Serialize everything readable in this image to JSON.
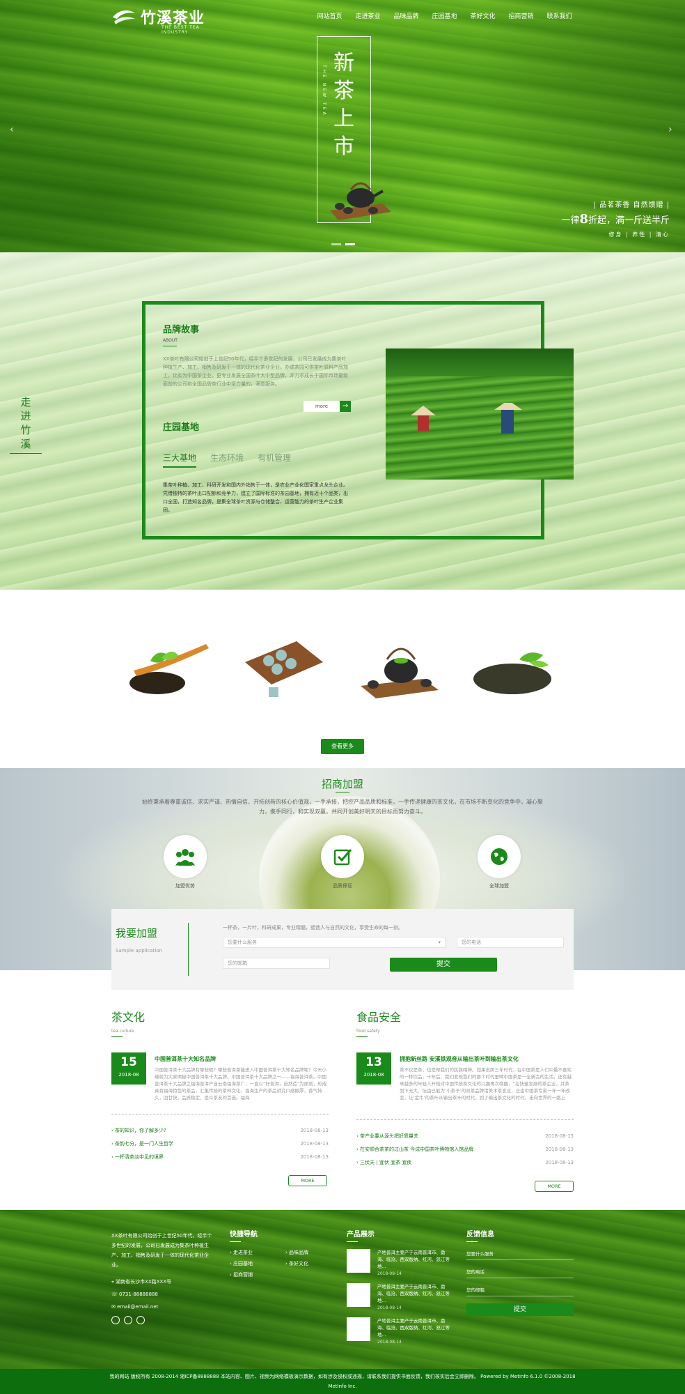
{
  "header": {
    "logo_text": "竹溪茶业",
    "logo_sub": "THE BEST TEA INDUSTRY",
    "nav": [
      "网站首页",
      "走进茶业",
      "品味品牌",
      "庄园基地",
      "茶好文化",
      "招商营销",
      "联系我们"
    ]
  },
  "hero": {
    "card_title": "新茶上市",
    "card_en": "THE NEW TEA",
    "slogan_line1": "| 品茗茶香 自然馈赠 |",
    "slogan_line2_a": "一律",
    "slogan_line2_b": "8",
    "slogan_line2_c": "折起，满一斤送半斤",
    "slogan_line3": "修身 | 养性 | 清心"
  },
  "about": {
    "side_title": "走进竹溪",
    "brand_title": "品牌故事",
    "brand_en": "ABOUT",
    "brand_text": "XX茶叶有限公司始创于上世纪50年代，经半个多世纪的发展，公司已发展成为集茶叶种植生产、加工、销售及研发于一体的现代化茶业企业。办成茶园可供茶叶原料产品加工，比实为中国茶企业。更专业发展全国茶叶大中型品牌，并力求成长于国际市场量级面前的公司和全国品牌茶行业中坚力量的，满意服务。",
    "more": "more",
    "base_title": "庄园基地",
    "tabs": [
      "三大基地",
      "生态环境",
      "有机管理"
    ],
    "base_text": "集茶叶种植、加工、科研开发和国内外销售于一体，是农业产业化国家重点龙头企业。凭借独特的茶叶出口配额和竞争力，建立了国际标准的茶园基地，拥有近十个品类，出口全国，打造知名品牌，是集全球茶叶资源与仓储整合、运营能力的茶叶生产企业集团。"
  },
  "products": {
    "items": [
      "茶叶与木勺",
      "功夫茶具套装",
      "茶壶与茶杯",
      "散装绿茶"
    ],
    "view_more": "查看更多"
  },
  "franchise": {
    "title": "招商加盟",
    "desc": "始终秉承着尊重诚信、求实严谨、热情自信、开拓创新的核心价值观，一手承接，把控产品品质和标准，一手传递健康的茶文化，在市场不断变化的竞争中，凝心聚力，携手同行，和实现双赢，共同开创美好明天的目标而努力奋斗。",
    "features": [
      "加盟优势",
      "品质保证",
      "全球加盟"
    ]
  },
  "join": {
    "title": "我要加盟",
    "en": "Sample application",
    "tip": "一杯茶，一片叶，科研成果，专业精髓，塑造人与自然的文化，享受生命的每一刻。",
    "select": "您要什么服务",
    "phone": "您的电话",
    "email": "您的邮箱",
    "submit": "提交"
  },
  "news": {
    "culture": {
      "title": "茶文化",
      "en": "tea culture",
      "day": "15",
      "ym": "2018-08",
      "feat_title": "中国普洱茶十大知名品牌",
      "feat_text": "中国普洱茶十大品牌有哪些呢？哪些普洱茶能进入中国普洱茶十大知名品牌呢？今天小编就为大家揭秘中国普洱茶十大品牌。中国普洱茶十大品牌之一——福海普洱茶。中国普洱茶十大品牌之福海普洱产自云南福海茶厂，一直以“好普洱，自然造”为原则，形成具有福海特色的茶品，汇集传统的茶林文化，福海生产的茶品讲究口感醇厚，香气持久，回甘快，品质稳定，是众茶友的首选。福海",
      "list": [
        {
          "t": "茶的知识，你了解多少?",
          "d": "2018-08-13"
        },
        {
          "t": "茶韵七分，是一门人生哲学",
          "d": "2018-08-13"
        },
        {
          "t": "一杯清茶淡中见的境界",
          "d": "2018-08-13"
        }
      ],
      "more": "MORE"
    },
    "safety": {
      "title": "食品安全",
      "en": "food safety",
      "day": "13",
      "ym": "2018-08",
      "feat_title": "拥抱新丝路 安溪铁观音从输出茶叶到输出茶文化",
      "feat_text": "茶不仅是茶，也是帮我们的民族精神。如果说照三年时代，在中国茶是人们中最不喜欢的一种饮品，十年后，我们发现我们的那个时代里喝中国茶是一全新完的生活，还有越来越多的年轻人开始对中国传统茶文化的兴趣再次唤醒，“在快速发展的茶企业，并茶到下无大，坛由已能为‘小茶子’的双茶品牌诸美术茶发业，正由中国茶专家一年一年改变，让‘金牛’的茶叶从输出茶叶的时代，到了输出茶文化的时代，走向世界的一路上",
      "list": [
        {
          "t": "茶产业要从源头把好质量关",
          "d": "2018-08-13"
        },
        {
          "t": "在安顺合茶茶的过山茶 今成中国茶叶博物馆入馆品牌",
          "d": "2018-08-13"
        },
        {
          "t": "三伏天 | 宜伏 宜茶 宜疾",
          "d": "2018-08-13"
        }
      ],
      "more": "MORE"
    }
  },
  "footer": {
    "about": "XX茶叶有限公司始创于上世纪50年代，经半个多世纪的发展，公司已发展成为集茶叶种植生产、加工、销售及研发于一体的现代化茶业企业。",
    "address": "湖南省长沙市XX路XXX号",
    "phone": "0731-88888888",
    "email": "email@email.net",
    "nav_title": "快捷导航",
    "nav": [
      "走进茶业",
      "品味品牌",
      "庄园基地",
      "茶好文化",
      "招商营销"
    ],
    "prod_title": "产品展示",
    "prods": [
      {
        "t": "产地普洱主要产于云南普洱市、勐海、临沧、西双版纳、红河、怒江等地...",
        "d": "2018-08-14"
      },
      {
        "t": "产地普洱主要产于云南普洱市、勐海、临沧、西双版纳、红河、怒江等地...",
        "d": "2018-08-14"
      },
      {
        "t": "产地普洱主要产于云南普洱市、勐海、临沧、西双版纳、红河、怒江等地...",
        "d": "2018-08-14"
      }
    ],
    "feedback_title": "反馈信息",
    "fb_name": "您要什么服务",
    "fb_phone": "您的电话",
    "fb_email": "您的邮箱",
    "fb_submit": "提交",
    "copyright_line1": "我的网站 版权所有 2008-2014 湘ICP备8888888 本站内容、图片、视频为网络模板演示数据，如有涉及侵权或违规，请联系我们提供书面反馈，我们核实后会立即删除。 Powered by Metinfo 6.1.0 ©2008-2018",
    "copyright_line2": "MetInfo Inc."
  }
}
